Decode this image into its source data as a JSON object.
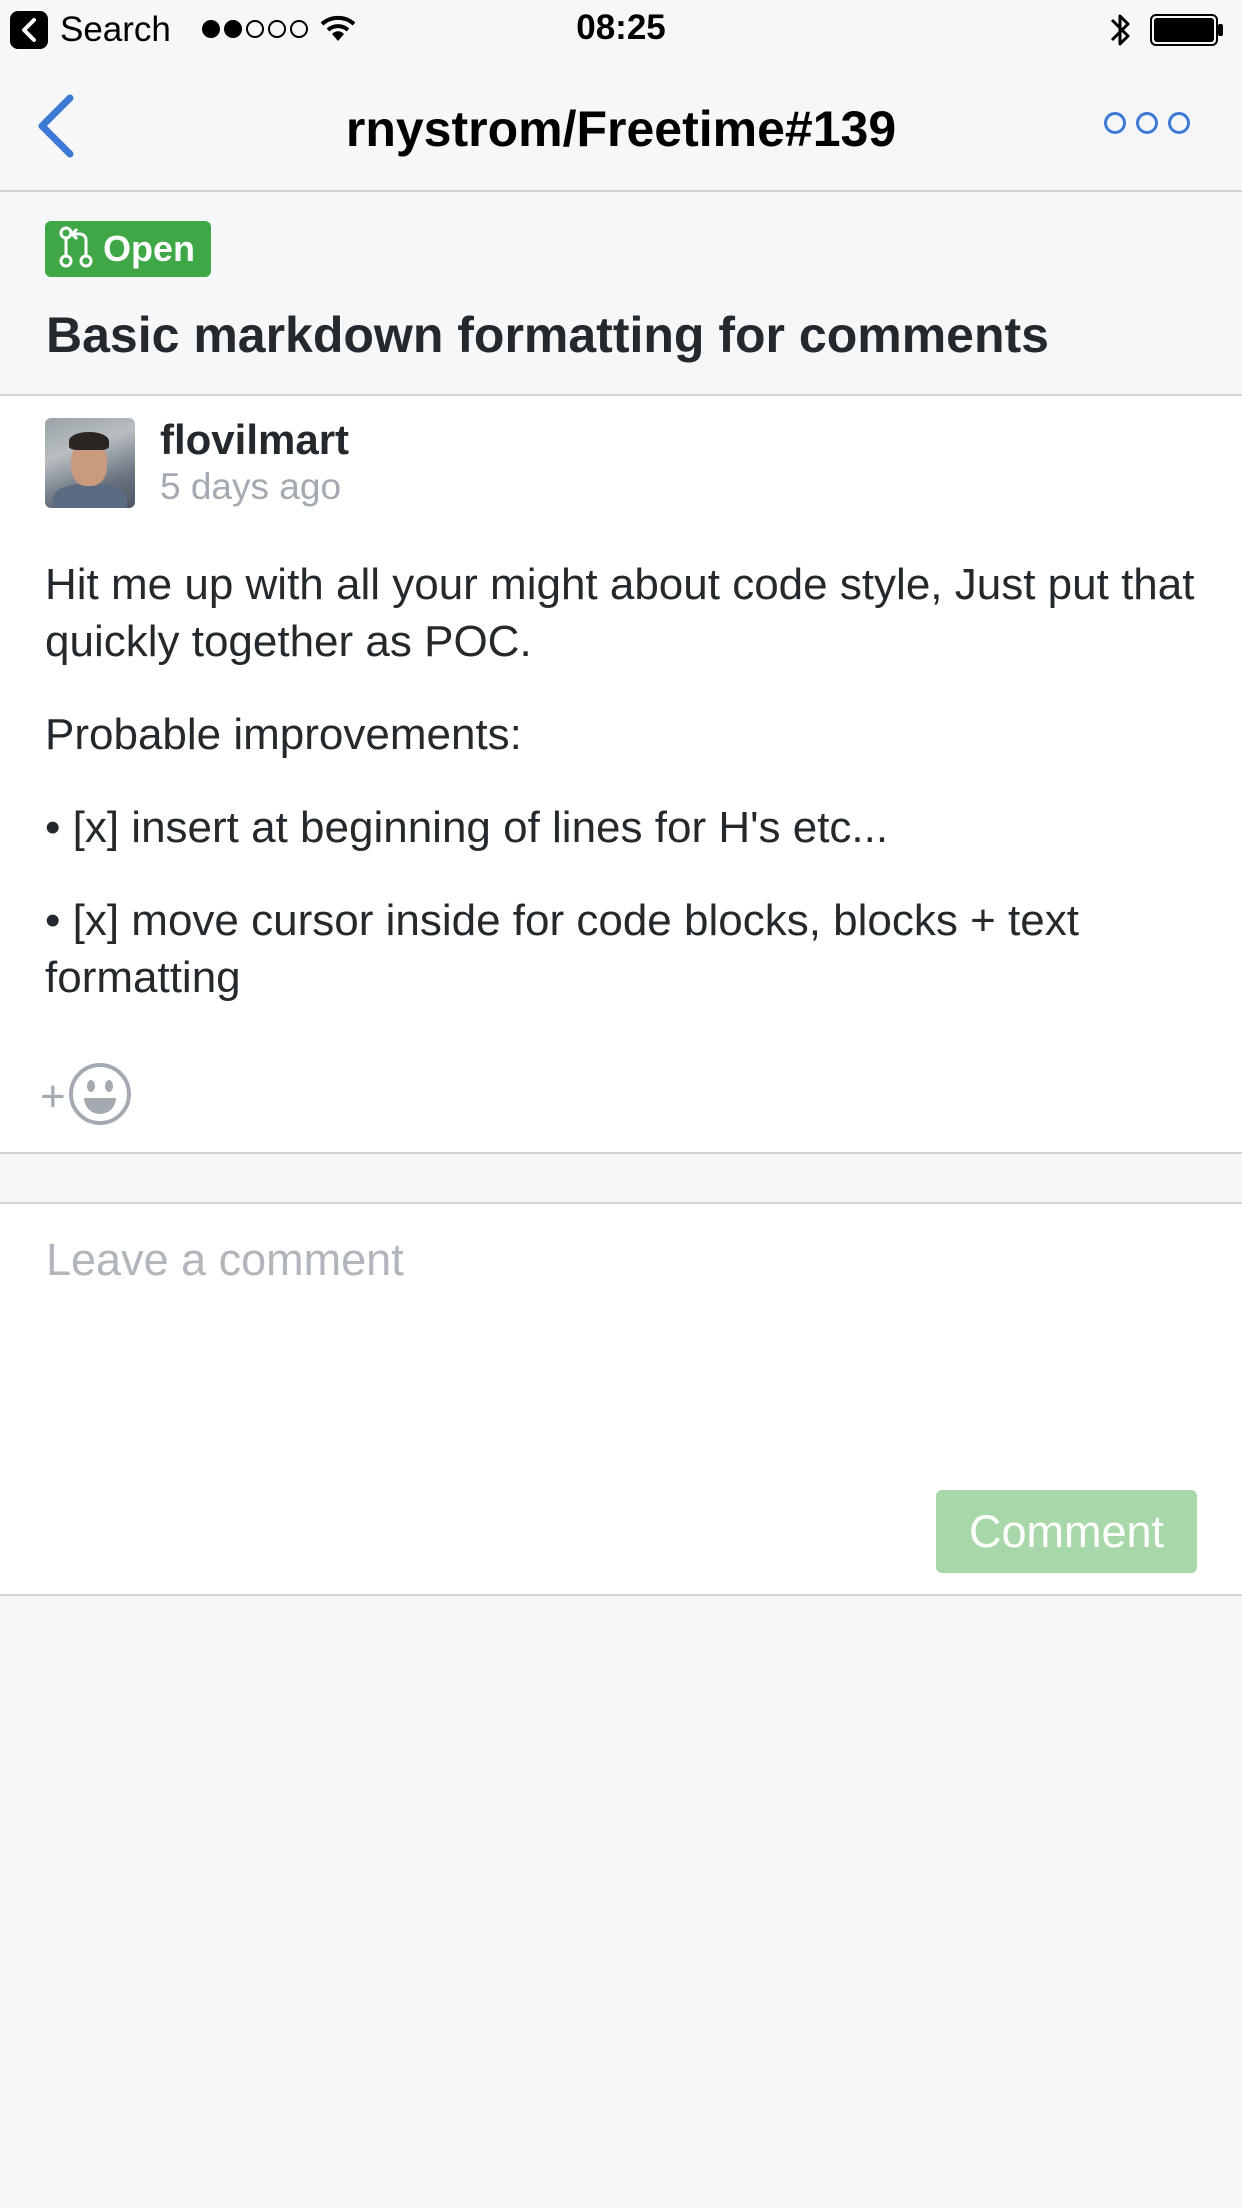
{
  "status_bar": {
    "back_app_label": "Search",
    "time": "08:25"
  },
  "nav": {
    "title": "rnystrom/Freetime#139"
  },
  "issue": {
    "state_label": "Open",
    "title": "Basic markdown formatting for comments",
    "state_color": "#3fa746"
  },
  "comment": {
    "author": "flovilmart",
    "timestamp": "5 days ago",
    "paragraphs": [
      "Hit me up with all your might about code style, Just put that quickly together as POC.",
      "Probable improvements:",
      "• [x] insert at beginning of lines for H's etc...",
      "• [x] move cursor inside for code blocks, blocks + text formatting"
    ],
    "reaction_plus": "+"
  },
  "composer": {
    "placeholder": "Leave a comment",
    "value": "",
    "submit_label": "Comment"
  },
  "colors": {
    "accent": "#3d7ad6",
    "button_disabled": "#a8d8a9",
    "background": "#f6f7f9"
  },
  "icons": {
    "status_back": "chevron-left-icon",
    "wifi": "wifi-icon",
    "bluetooth": "bluetooth-icon",
    "battery": "battery-icon",
    "nav_back": "chevron-left-icon",
    "more": "ellipsis-icon",
    "pull_request": "pull-request-icon",
    "emoji": "smiley-icon"
  }
}
